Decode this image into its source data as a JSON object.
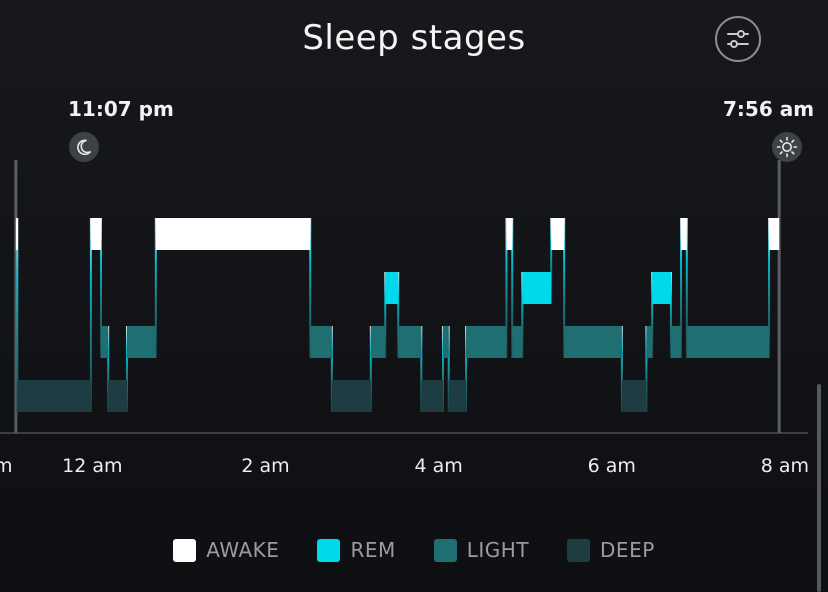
{
  "header": {
    "title": "Sleep stages",
    "filter_icon": "sliders-icon"
  },
  "markers": {
    "start": {
      "label": "11:07 pm",
      "icon": "moon-icon"
    },
    "end": {
      "label": "7:56 am",
      "icon": "sun-icon"
    }
  },
  "colors": {
    "background": "#121316",
    "AWAKE": "#ffffff",
    "REM": "#00d8ec",
    "LIGHT": "#1f6e72",
    "DEEP": "#1d3d43",
    "axis": "#4a4d52"
  },
  "chart_data": {
    "type": "hypnogram",
    "title": "Sleep stages",
    "x_ticks": [
      "12 am",
      "2 am",
      "4 am",
      "6 am",
      "8 am"
    ],
    "x_tick_values": [
      0,
      120,
      240,
      360,
      480
    ],
    "x_range_minutes_from_midnight": [
      -64,
      496
    ],
    "stages": [
      "AWAKE",
      "REM",
      "LIGHT",
      "DEEP"
    ],
    "legend": [
      {
        "label": "AWAKE",
        "stage": "AWAKE"
      },
      {
        "label": "REM",
        "stage": "REM"
      },
      {
        "label": "LIGHT",
        "stage": "LIGHT"
      },
      {
        "label": "DEEP",
        "stage": "DEEP"
      }
    ],
    "start_time": "11:07 pm",
    "end_time": "7:56 am",
    "segments": [
      {
        "stage": "AWAKE",
        "start": "11:07 pm",
        "end": "11:08 pm"
      },
      {
        "stage": "DEEP",
        "start": "11:08 pm",
        "end": "11:59 pm"
      },
      {
        "stage": "AWAKE",
        "start": "11:59 pm",
        "end": "12:06 am"
      },
      {
        "stage": "LIGHT",
        "start": "12:06 am",
        "end": "12:11 am"
      },
      {
        "stage": "DEEP",
        "start": "12:11 am",
        "end": "12:24 am"
      },
      {
        "stage": "LIGHT",
        "start": "12:24 am",
        "end": "12:44 am"
      },
      {
        "stage": "AWAKE",
        "start": "12:44 am",
        "end": "2:31 am"
      },
      {
        "stage": "LIGHT",
        "start": "2:31 am",
        "end": "2:46 am"
      },
      {
        "stage": "DEEP",
        "start": "2:46 am",
        "end": "3:13 am"
      },
      {
        "stage": "LIGHT",
        "start": "3:13 am",
        "end": "3:23 am"
      },
      {
        "stage": "REM",
        "start": "3:23 am",
        "end": "3:32 am"
      },
      {
        "stage": "LIGHT",
        "start": "3:32 am",
        "end": "3:48 am"
      },
      {
        "stage": "DEEP",
        "start": "3:48 am",
        "end": "4:03 am"
      },
      {
        "stage": "LIGHT",
        "start": "4:03 am",
        "end": "4:07 am"
      },
      {
        "stage": "DEEP",
        "start": "4:07 am",
        "end": "4:19 am"
      },
      {
        "stage": "LIGHT",
        "start": "4:19 am",
        "end": "4:47 am"
      },
      {
        "stage": "AWAKE",
        "start": "4:47 am",
        "end": "4:51 am"
      },
      {
        "stage": "LIGHT",
        "start": "4:51 am",
        "end": "4:58 am"
      },
      {
        "stage": "REM",
        "start": "4:58 am",
        "end": "5:18 am"
      },
      {
        "stage": "AWAKE",
        "start": "5:18 am",
        "end": "5:27 am"
      },
      {
        "stage": "LIGHT",
        "start": "5:27 am",
        "end": "6:07 am"
      },
      {
        "stage": "DEEP",
        "start": "6:07 am",
        "end": "6:24 am"
      },
      {
        "stage": "LIGHT",
        "start": "6:24 am",
        "end": "6:28 am"
      },
      {
        "stage": "REM",
        "start": "6:28 am",
        "end": "6:41 am"
      },
      {
        "stage": "LIGHT",
        "start": "6:41 am",
        "end": "6:48 am"
      },
      {
        "stage": "AWAKE",
        "start": "6:48 am",
        "end": "6:52 am"
      },
      {
        "stage": "LIGHT",
        "start": "6:52 am",
        "end": "7:49 am"
      },
      {
        "stage": "AWAKE",
        "start": "7:49 am",
        "end": "7:56 am"
      }
    ]
  }
}
